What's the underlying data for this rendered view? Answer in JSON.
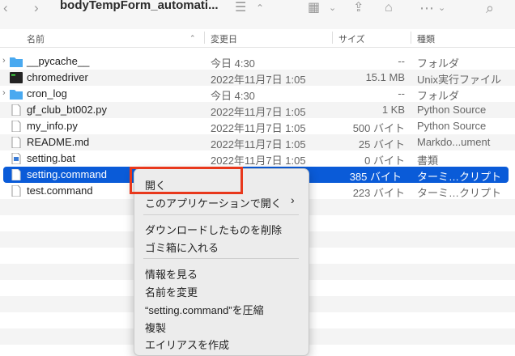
{
  "toolbar": {
    "title": "bodyTempForm_automati...",
    "back": "‹",
    "forward": "›",
    "list_icon": "☰",
    "view_icon": "▦",
    "share_icon": "⇪",
    "tag_icon": "⌂",
    "more_icon": "⋯",
    "search_icon": "⌕"
  },
  "columns": {
    "name": "名前",
    "date": "変更日",
    "size": "サイズ",
    "kind": "種類"
  },
  "files": [
    {
      "name": "__pycache__",
      "date": "今日 4:30",
      "size": "--",
      "kind": "フォルダ",
      "type": "folder"
    },
    {
      "name": "chromedriver",
      "date": "2022年11月7日 1:05",
      "size": "15.1 MB",
      "kind": "Unix実行ファイル",
      "type": "exec"
    },
    {
      "name": "cron_log",
      "date": "今日 4:30",
      "size": "--",
      "kind": "フォルダ",
      "type": "folder"
    },
    {
      "name": "gf_club_bt002.py",
      "date": "2022年11月7日 1:05",
      "size": "1 KB",
      "kind": "Python Source",
      "type": "doc"
    },
    {
      "name": "my_info.py",
      "date": "2022年11月7日 1:05",
      "size": "500 バイト",
      "kind": "Python Source",
      "type": "doc"
    },
    {
      "name": "README.md",
      "date": "2022年11月7日 1:05",
      "size": "25 バイト",
      "kind": "Markdo...ument",
      "type": "doc"
    },
    {
      "name": "setting.bat",
      "date": "2022年11月7日 1:05",
      "size": "0 バイト",
      "kind": "書類",
      "type": "bat"
    },
    {
      "name": "setting.command",
      "date": "",
      "size": "385 バイト",
      "kind": "ターミ…クリプト",
      "type": "doc"
    },
    {
      "name": "test.command",
      "date": "",
      "size": "223 バイト",
      "kind": "ターミ…クリプト",
      "type": "doc"
    }
  ],
  "menu": {
    "open": "開く",
    "open_with": "このアプリケーションで開く",
    "delete_downloaded": "ダウンロードしたものを削除",
    "trash": "ゴミ箱に入れる",
    "info": "情報を見る",
    "rename": "名前を変更",
    "compress": "“setting.command”を圧縮",
    "duplicate": "複製",
    "alias": "エイリアスを作成"
  }
}
